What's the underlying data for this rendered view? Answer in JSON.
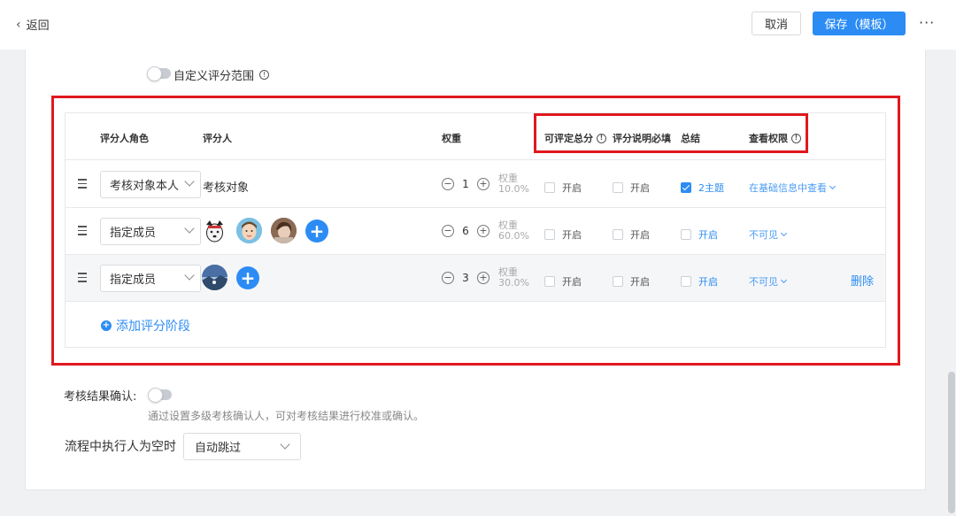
{
  "topbar": {
    "back_label": "返回",
    "cancel_label": "取消",
    "save_label": "保存（模板）",
    "more_label": "···"
  },
  "custom_range": {
    "label": "自定义评分范围",
    "enabled": false
  },
  "table": {
    "headers": {
      "role": "评分人角色",
      "rater": "评分人",
      "weight": "权重",
      "total": "可评定总分",
      "required": "评分说明必填",
      "summary": "总结",
      "permission": "查看权限"
    },
    "rows": [
      {
        "role": "考核对象本人",
        "rater_text": "考核对象",
        "weight": "1",
        "weight_label": "权重",
        "weight_pct": "10.0%",
        "total_label": "开启",
        "required_label": "开启",
        "summary_label": "2主题",
        "summary_checked": true,
        "permission": "在基础信息中查看"
      },
      {
        "role": "指定成员",
        "weight": "6",
        "weight_label": "权重",
        "weight_pct": "60.0%",
        "total_label": "开启",
        "required_label": "开启",
        "summary_label": "开启",
        "summary_checked": false,
        "permission": "不可见"
      },
      {
        "role": "指定成员",
        "weight": "3",
        "weight_label": "权重",
        "weight_pct": "30.0%",
        "total_label": "开启",
        "required_label": "开启",
        "summary_label": "开启",
        "summary_checked": false,
        "permission": "不可见",
        "delete_label": "删除"
      }
    ],
    "add_stage_label": "添加评分阶段"
  },
  "confirm": {
    "label": "考核结果确认:",
    "enabled": false,
    "hint": "通过设置多级考核确认人，可对考核结果进行校准或确认。"
  },
  "empty_executor": {
    "label": "流程中执行人为空时",
    "value": "自动跳过"
  },
  "colors": {
    "accent": "#2c8cf4",
    "highlight": "#e0181f"
  }
}
